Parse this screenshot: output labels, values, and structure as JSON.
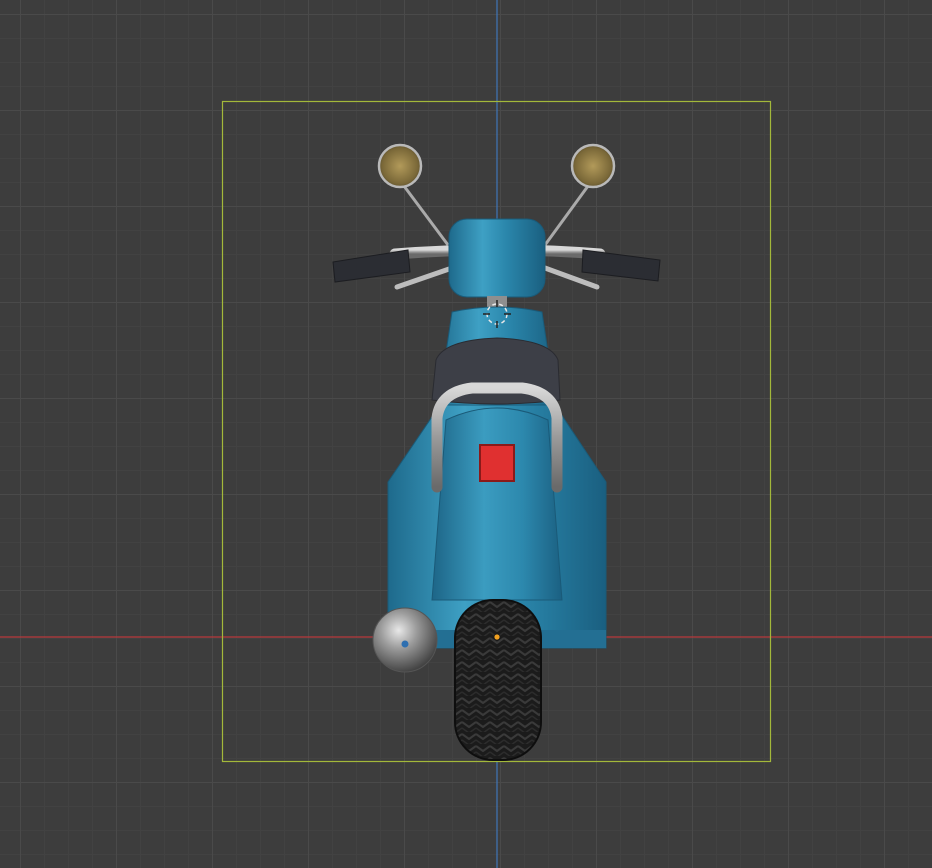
{
  "viewport": {
    "view": "front",
    "grid_visible": true,
    "colors": {
      "background": "#3d3d3d",
      "grid_major": "#4a4a4a",
      "grid_minor": "#424242",
      "x_axis": "#b8393c",
      "z_axis": "#3f76b8",
      "camera_frame": "#a3b83a",
      "origin": "#f0a020"
    }
  },
  "scene": {
    "object": "scooter",
    "colors": {
      "body": "#2a86ab",
      "body_dark": "#1f6c8e",
      "body_light": "#4aa6c8",
      "seat": "#3d3f47",
      "chrome": "#a9a9a9",
      "grip": "#2b2d33",
      "mirror": "#8a7846",
      "tail_light": "#e03030",
      "tire": "#1e1e1e"
    },
    "icons": [
      "pivot-cursor-icon",
      "origin-dot-icon"
    ]
  }
}
